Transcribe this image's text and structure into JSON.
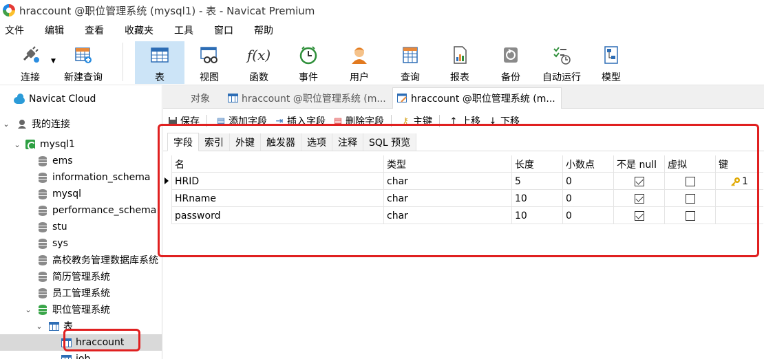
{
  "window": {
    "title": "hraccount @职位管理系统 (mysql1) - 表 - Navicat Premium"
  },
  "menu": [
    "文件",
    "编辑",
    "查看",
    "收藏夹",
    "工具",
    "窗口",
    "帮助"
  ],
  "toolbar": {
    "connect": "连接",
    "new_query": "新建查询",
    "buttons": [
      "表",
      "视图",
      "函数",
      "事件",
      "用户",
      "查询",
      "报表",
      "备份",
      "自动运行",
      "模型"
    ]
  },
  "sidebar": {
    "cloud": "Navicat Cloud",
    "my_connections": "我的连接",
    "connection": "mysql1",
    "databases": [
      "ems",
      "information_schema",
      "mysql",
      "performance_schema",
      "stu",
      "sys",
      "高校教务管理数据库系统",
      "简历管理系统",
      "员工管理系统"
    ],
    "open_db": "职位管理系统",
    "tables_folder": "表",
    "tables": [
      "hraccount",
      "job"
    ]
  },
  "tabs": {
    "objects": "对象",
    "tab1": "hraccount @职位管理系统 (m...",
    "tab2": "hraccount @职位管理系统 (m..."
  },
  "design_toolbar": [
    "保存",
    "添加字段",
    "插入字段",
    "删除字段",
    "主键",
    "上移",
    "下移"
  ],
  "subtabs": [
    "字段",
    "索引",
    "外键",
    "触发器",
    "选项",
    "注释",
    "SQL 预览"
  ],
  "fields": {
    "headers": [
      "名",
      "类型",
      "长度",
      "小数点",
      "不是 null",
      "虚拟",
      "键"
    ],
    "rows": [
      {
        "name": "HRID",
        "type": "char",
        "length": "5",
        "decimals": "0",
        "not_null": true,
        "virtual": false,
        "key": "1"
      },
      {
        "name": "HRname",
        "type": "char",
        "length": "10",
        "decimals": "0",
        "not_null": true,
        "virtual": false,
        "key": ""
      },
      {
        "name": "password",
        "type": "char",
        "length": "10",
        "decimals": "0",
        "not_null": true,
        "virtual": false,
        "key": ""
      }
    ]
  },
  "colors": {
    "highlight": "#e02020",
    "selected_tool": "#cce4f7"
  }
}
